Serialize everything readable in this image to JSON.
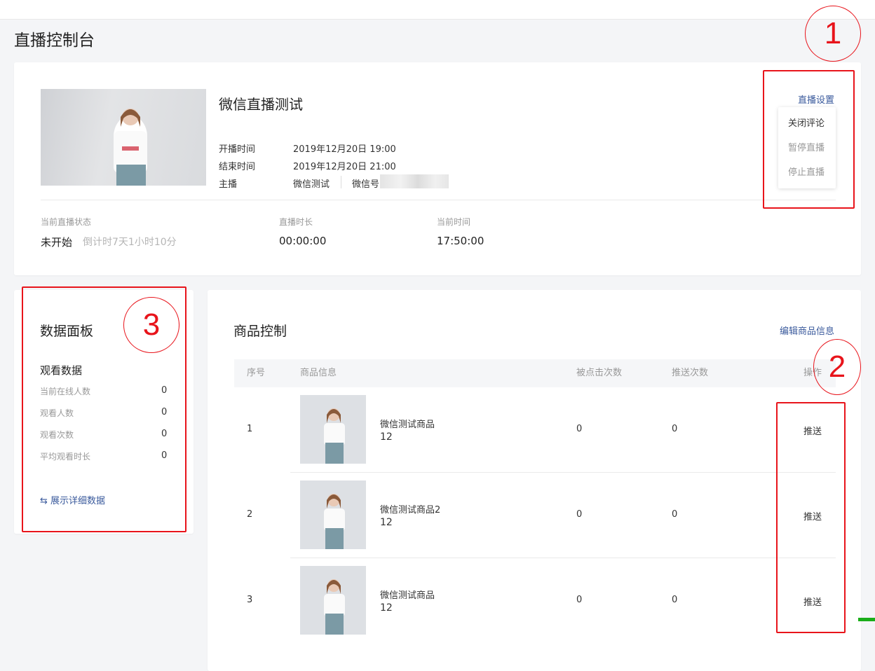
{
  "page_title": "直播控制台",
  "live": {
    "title": "微信直播测试",
    "start_label": "开播时间",
    "start_value": "2019年12月20日 19:00",
    "end_label": "结束时间",
    "end_value": "2019年12月20日 21:00",
    "host_label": "主播",
    "host_name": "微信测试",
    "wechat_label": "微信号"
  },
  "settings": {
    "link_label": "直播设置",
    "menu": [
      "关闭评论",
      "暂停直播",
      "停止直播"
    ]
  },
  "status": {
    "state_label": "当前直播状态",
    "state_value": "未开始",
    "countdown": "倒计时7天1小时10分",
    "duration_label": "直播时长",
    "duration_value": "00:00:00",
    "time_label": "当前时间",
    "time_value": "17:50:00"
  },
  "data_panel": {
    "title": "数据面板",
    "section": "观看数据",
    "items": [
      {
        "label": "当前在线人数",
        "value": "0"
      },
      {
        "label": "观看人数",
        "value": "0"
      },
      {
        "label": "观看次数",
        "value": "0"
      },
      {
        "label": "平均观看时长",
        "value": "0"
      }
    ],
    "expand_label": "展示详细数据"
  },
  "goods": {
    "title": "商品控制",
    "edit_label": "编辑商品信息",
    "columns": [
      "序号",
      "商品信息",
      "被点击次数",
      "推送次数",
      "操作"
    ],
    "rows": [
      {
        "index": "1",
        "name": "微信测试商品",
        "price": "12",
        "clicks": "0",
        "pushes": "0",
        "action": "推送"
      },
      {
        "index": "2",
        "name": "微信测试商品2",
        "price": "12",
        "clicks": "0",
        "pushes": "0",
        "action": "推送"
      },
      {
        "index": "3",
        "name": "微信测试商品",
        "price": "12",
        "clicks": "0",
        "pushes": "0",
        "action": "推送"
      }
    ]
  },
  "annotations": [
    "1",
    "2",
    "3"
  ],
  "colors": {
    "accent": "#3a5a9c",
    "highlight": "#e8141b"
  }
}
